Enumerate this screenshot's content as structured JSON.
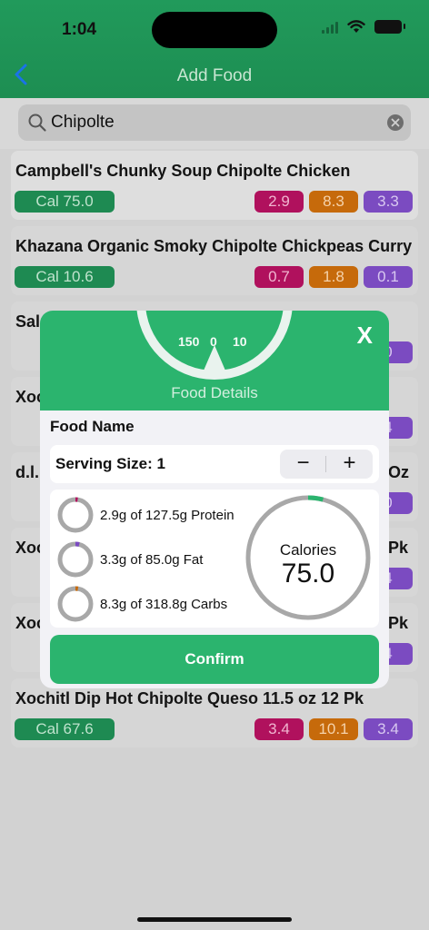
{
  "status": {
    "time": "1:04"
  },
  "nav": {
    "title": "Add Food"
  },
  "search": {
    "value": "Chipolte",
    "placeholder": ""
  },
  "colors": {
    "accent": "#2bb46e",
    "protein": "#b0115d",
    "carbs": "#c66a0b",
    "fat": "#7b4bc1"
  },
  "results": [
    {
      "name": "Campbell's Chunky Soup Chipolte Chicken",
      "cal": "Cal 75.0",
      "protein": "2.9",
      "carbs": "8.3",
      "fat": "3.3"
    },
    {
      "name": "Khazana Organic Smoky Chipolte Chickpeas Curry",
      "cal": "Cal 10.6",
      "protein": "0.7",
      "carbs": "1.8",
      "fat": "0.1"
    },
    {
      "name": "Sals",
      "cal": "",
      "protein": "",
      "carbs": "",
      "fat": "0"
    },
    {
      "name": "Xoc",
      "cal": "",
      "protein": "",
      "carbs": "",
      "fat": "4"
    },
    {
      "name": "d.l.",
      "name_tail": "Oz",
      "cal": "",
      "protein": "",
      "carbs": "",
      "fat": "0"
    },
    {
      "name": "Xoc",
      "name_tail": "Pk",
      "cal": "",
      "protein": "",
      "carbs": "",
      "fat": "4"
    },
    {
      "name": "Xoc",
      "name_tail": "Pk",
      "cal": "",
      "protein": "",
      "carbs": "",
      "fat": "4"
    },
    {
      "name": "Xochitl Dip Hot Chipolte Queso 11.5 oz 12 Pk",
      "cal": "Cal 67.6",
      "protein": "3.4",
      "carbs": "10.1",
      "fat": "3.4"
    }
  ],
  "modal": {
    "close_label": "X",
    "title": "Food Details",
    "scale_labels": [
      "150",
      "0",
      "10"
    ],
    "food_name_label": "Food Name",
    "serving_label": "Serving Size: 1",
    "minus_label": "−",
    "plus_label": "+",
    "macros": [
      {
        "text": "2.9g of 127.5g Protein",
        "fraction": 0.023,
        "color": "#b0115d"
      },
      {
        "text": "3.3g of 85.0g Fat",
        "fraction": 0.039,
        "color": "#7b4bc1"
      },
      {
        "text": "8.3g of 318.8g Carbs",
        "fraction": 0.026,
        "color": "#c66a0b"
      }
    ],
    "calories_label": "Calories",
    "calories_value": "75.0",
    "calories_fraction": 0.04,
    "confirm_label": "Confirm"
  }
}
